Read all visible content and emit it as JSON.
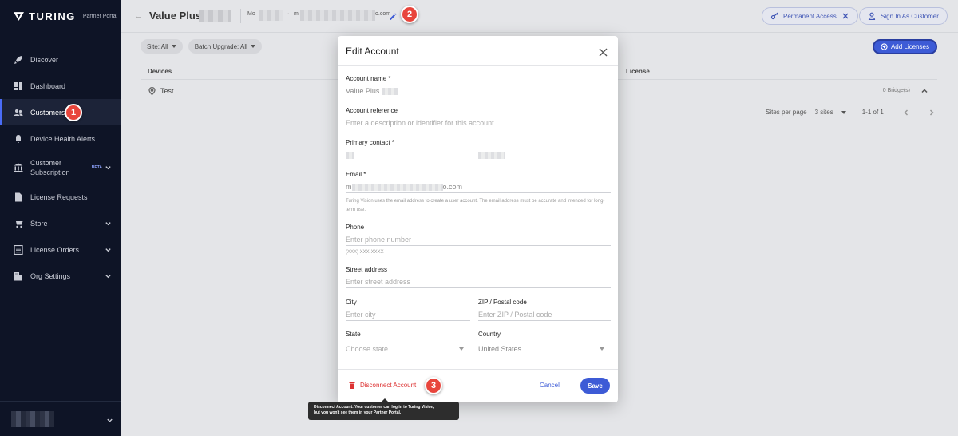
{
  "sidebar": {
    "logo_text": "TURING",
    "logo_sub": "Partner Portal",
    "items": [
      {
        "label": "Discover",
        "icon": "rocket-icon"
      },
      {
        "label": "Dashboard",
        "icon": "dashboard-icon"
      },
      {
        "label": "Customers",
        "icon": "people-icon",
        "active": true
      },
      {
        "label": "Device Health Alerts",
        "icon": "bell-icon"
      },
      {
        "label_line1": "Customer",
        "label_line2": "Subscription",
        "beta": "BETA",
        "icon": "bank-icon"
      },
      {
        "label": "License Requests",
        "icon": "document-icon"
      },
      {
        "label": "Store",
        "icon": "cart-icon"
      },
      {
        "label": "License Orders",
        "icon": "list-icon"
      },
      {
        "label": "Org Settings",
        "icon": "building-icon"
      }
    ]
  },
  "header": {
    "back": "←",
    "title": "Value Plus",
    "contact_prefix": "Mo",
    "contact_mid": "m",
    "contact_suffix": "o.com",
    "permanent_access": "Permanent Access",
    "sign_in_as_customer": "Sign In As Customer"
  },
  "filters": {
    "site": "Site: All",
    "batch": "Batch Upgrade: All",
    "add_licenses": "Add Licenses"
  },
  "table": {
    "col_devices": "Devices",
    "col_license": "License",
    "row_name": "Test",
    "row_bridges": "0 Bridge(s)"
  },
  "pager": {
    "sites_per_page": "Sites per page",
    "page_size": "3 sites",
    "range": "1-1 of 1"
  },
  "modal": {
    "title": "Edit Account",
    "account_name_label": "Account name *",
    "account_name_value": "Value Plus",
    "account_ref_label": "Account reference",
    "account_ref_placeholder": "Enter a description or identifier for this account",
    "primary_contact_label": "Primary contact *",
    "email_label": "Email *",
    "email_prefix": "m",
    "email_suffix": "o.com",
    "email_helper": "Turing Vision uses the email address to create a user account. The email address must be accurate and intended for long-term use.",
    "phone_label": "Phone",
    "phone_placeholder": "Enter phone number",
    "phone_helper": "(XXX) XXX-XXXX",
    "street_label": "Street address",
    "street_placeholder": "Enter street address",
    "city_label": "City",
    "city_placeholder": "Enter city",
    "zip_label": "ZIP / Postal code",
    "zip_placeholder": "Enter ZIP / Postal code",
    "state_label": "State",
    "state_placeholder": "Choose state",
    "country_label": "Country",
    "country_value": "United States",
    "disconnect": "Disconnect Account",
    "cancel": "Cancel",
    "save": "Save"
  },
  "tooltip": {
    "line1": "Disconnect Account: Your customer can log in to Turing Vision,",
    "line2": "but you won't see them in your Partner Portal."
  },
  "badges": [
    "1",
    "2",
    "3"
  ],
  "colors": {
    "accent": "#3d5bd6",
    "sidebar": "#0e1426",
    "danger": "#d33",
    "badge": "#e8453c"
  }
}
